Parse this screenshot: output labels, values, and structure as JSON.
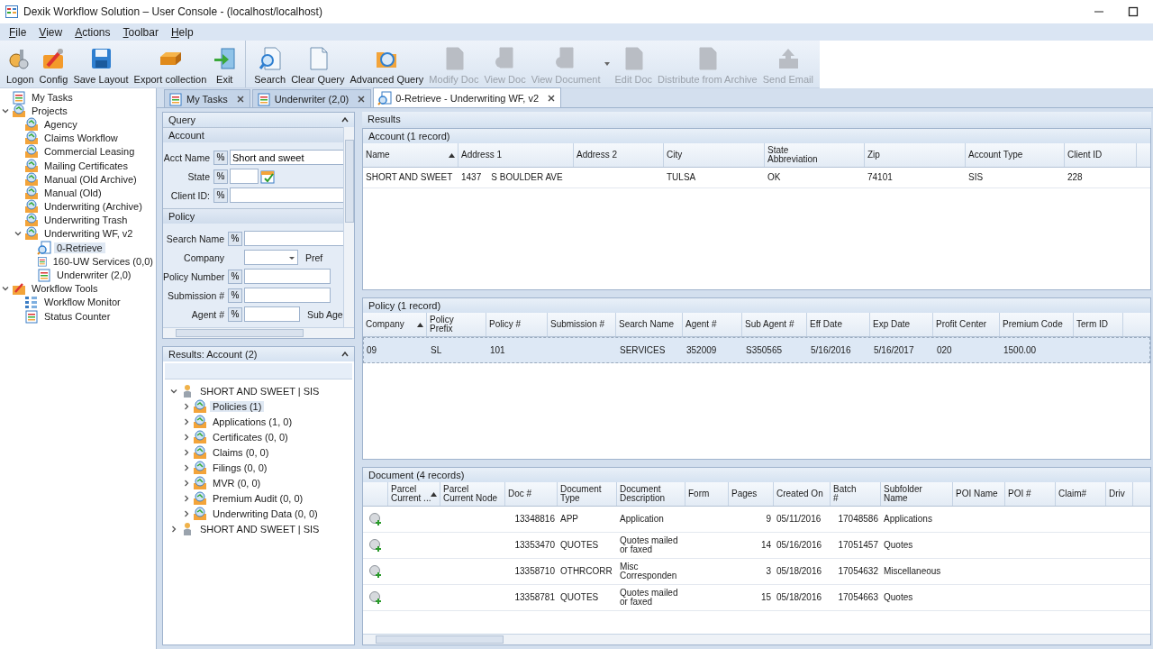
{
  "window": {
    "title": "Dexik Workflow Solution – User Console - (localhost/localhost)"
  },
  "menu": [
    "File",
    "View",
    "Actions",
    "Toolbar",
    "Help"
  ],
  "toolbar": [
    {
      "label": "Logon",
      "disabled": false,
      "menu": false,
      "group_start": false
    },
    {
      "label": "Config",
      "disabled": false,
      "menu": false,
      "group_start": false
    },
    {
      "label": "Save Layout",
      "disabled": false,
      "menu": false,
      "group_start": false
    },
    {
      "label": "Export collection",
      "disabled": false,
      "menu": false,
      "group_start": false
    },
    {
      "label": "Exit",
      "disabled": false,
      "menu": false,
      "group_start": false
    },
    {
      "label": "Search",
      "disabled": false,
      "menu": false,
      "group_start": true
    },
    {
      "label": "Clear Query",
      "disabled": false,
      "menu": false,
      "group_start": false
    },
    {
      "label": "Advanced Query",
      "disabled": false,
      "menu": false,
      "group_start": false
    },
    {
      "label": "Modify Doc",
      "disabled": true,
      "menu": false,
      "group_start": false
    },
    {
      "label": "View Doc",
      "disabled": true,
      "menu": false,
      "group_start": false
    },
    {
      "label": "View Document",
      "disabled": true,
      "menu": true,
      "group_start": false
    },
    {
      "label": "Edit Doc",
      "disabled": true,
      "menu": false,
      "group_start": false
    },
    {
      "label": "Distribute from Archive",
      "disabled": true,
      "menu": false,
      "group_start": false
    },
    {
      "label": "Send Email",
      "disabled": true,
      "menu": false,
      "group_start": false
    }
  ],
  "sidebar": {
    "items": [
      {
        "label": "My Tasks",
        "kind": "list",
        "selected": false
      },
      {
        "label": "Projects",
        "kind": "project",
        "selected": false,
        "expanded": true,
        "children": [
          {
            "label": "Agency",
            "kind": "project",
            "selected": false
          },
          {
            "label": "Claims Workflow",
            "kind": "project",
            "selected": false
          },
          {
            "label": "Commercial Leasing",
            "kind": "project",
            "selected": false
          },
          {
            "label": "Mailing Certificates",
            "kind": "project",
            "selected": false
          },
          {
            "label": "Manual (Old Archive)",
            "kind": "project",
            "selected": false
          },
          {
            "label": "Manual (Old)",
            "kind": "project",
            "selected": false
          },
          {
            "label": "Underwriting (Archive)",
            "kind": "project",
            "selected": false
          },
          {
            "label": "Underwriting Trash",
            "kind": "project",
            "selected": false
          },
          {
            "label": "Underwriting WF, v2",
            "kind": "project",
            "selected": false,
            "expanded": true,
            "children": [
              {
                "label": "0-Retrieve",
                "kind": "search",
                "selected": true
              },
              {
                "label": "160-UW Services (0,0)",
                "kind": "list",
                "selected": false
              },
              {
                "label": "Underwriter (2,0)",
                "kind": "list",
                "selected": false
              }
            ]
          }
        ]
      },
      {
        "label": "Workflow Tools",
        "kind": "tools",
        "selected": false,
        "expanded": true,
        "children": [
          {
            "label": "Workflow Monitor",
            "kind": "monitor",
            "selected": false
          },
          {
            "label": "Status Counter",
            "kind": "list",
            "selected": false
          }
        ]
      }
    ]
  },
  "tabs": [
    {
      "label": "My Tasks",
      "kind": "list",
      "selected": false
    },
    {
      "label": "Underwriter (2,0)",
      "kind": "list",
      "selected": false
    },
    {
      "label": "0-Retrieve - Underwriting WF, v2",
      "kind": "search",
      "selected": true
    }
  ],
  "query": {
    "title": "Query",
    "sections": [
      {
        "title": "Account",
        "fields": [
          {
            "label": "Acct Name",
            "operator": "%",
            "kind": "text",
            "value": "Short and sweet"
          },
          {
            "label": "State",
            "operator": "%",
            "kind": "date"
          },
          {
            "label": "Client ID:",
            "operator": "%",
            "kind": "text"
          }
        ]
      },
      {
        "title": "Policy",
        "fields": [
          {
            "label": "Search Name",
            "operator": "%",
            "kind": "text"
          },
          {
            "label": "Company",
            "kind": "dropdown",
            "side_label": "Pref"
          },
          {
            "label": "Policy Number",
            "operator": "%",
            "kind": "text"
          },
          {
            "label": "Submission #",
            "operator": "%",
            "kind": "text"
          },
          {
            "label": "Agent #",
            "operator": "%",
            "kind": "text",
            "side_label": "Sub Age"
          }
        ]
      }
    ]
  },
  "results_tree": {
    "title": "Results: Account (2)",
    "items": [
      {
        "label": "SHORT AND SWEET | SIS",
        "kind": "person",
        "selected": false,
        "expanded": true,
        "children": [
          {
            "label": "Policies (1)",
            "kind": "project",
            "selected": true,
            "expanded": false
          },
          {
            "label": "Applications (1, 0)",
            "kind": "project",
            "selected": false,
            "expanded": false
          },
          {
            "label": "Certificates (0, 0)",
            "kind": "project",
            "selected": false,
            "expanded": false
          },
          {
            "label": "Claims (0, 0)",
            "kind": "project",
            "selected": false,
            "expanded": false
          },
          {
            "label": "Filings (0, 0)",
            "kind": "project",
            "selected": false,
            "expanded": false
          },
          {
            "label": "MVR (0, 0)",
            "kind": "project",
            "selected": false,
            "expanded": false
          },
          {
            "label": "Premium Audit (0, 0)",
            "kind": "project",
            "selected": false,
            "expanded": false
          },
          {
            "label": "Underwriting Data (0, 0)",
            "kind": "project",
            "selected": false,
            "expanded": false
          }
        ]
      },
      {
        "label": "SHORT AND SWEET | SIS",
        "kind": "person",
        "selected": false,
        "expanded": false
      }
    ]
  },
  "results": {
    "title": "Results",
    "tables": [
      {
        "title": "Account (1 record)",
        "row_icons": false,
        "columns": [
          {
            "label": "Name",
            "sorted": true
          },
          {
            "label": "Address 1",
            "sorted": false
          },
          {
            "label": "Address 2",
            "sorted": false
          },
          {
            "label": "City",
            "sorted": false
          },
          {
            "label": "State\nAbbreviation",
            "sorted": false
          },
          {
            "label": "Zip",
            "sorted": false
          },
          {
            "label": "Account Type",
            "sorted": false
          },
          {
            "label": "Client ID",
            "sorted": false
          }
        ],
        "rows": [
          {
            "selected": false,
            "cells": [
              "SHORT AND SWEET",
              "1437    S BOULDER AVE",
              null,
              "TULSA",
              "OK",
              "74101",
              "SIS",
              "228"
            ]
          }
        ]
      },
      {
        "title": "Policy (1 record)",
        "row_icons": false,
        "columns": [
          {
            "label": "Company",
            "sorted": true
          },
          {
            "label": "Policy\nPrefix",
            "sorted": false
          },
          {
            "label": "Policy #",
            "sorted": false
          },
          {
            "label": "Submission #",
            "sorted": false
          },
          {
            "label": "Search Name",
            "sorted": false
          },
          {
            "label": "Agent #",
            "sorted": false
          },
          {
            "label": "Sub Agent #",
            "sorted": false
          },
          {
            "label": "Eff Date",
            "sorted": false
          },
          {
            "label": "Exp Date",
            "sorted": false
          },
          {
            "label": "Profit Center",
            "sorted": false
          },
          {
            "label": "Premium Code",
            "sorted": false
          },
          {
            "label": "Term ID",
            "sorted": false
          }
        ],
        "rows": [
          {
            "selected": true,
            "cells": [
              "09",
              "SL",
              "101",
              null,
              "SERVICES",
              "352009",
              "S350565",
              "5/16/2016",
              "5/16/2017",
              "020",
              "1500.00",
              null
            ]
          }
        ]
      },
      {
        "title": "Document (4 records)",
        "row_icons": true,
        "columns": [
          {
            "label": "Parcel\nCurrent ...",
            "sorted": true
          },
          {
            "label": "Parcel\nCurrent Node",
            "sorted": false
          },
          {
            "label": "Doc #",
            "sorted": false
          },
          {
            "label": "Document\nType",
            "sorted": false
          },
          {
            "label": "Document\nDescription",
            "sorted": false
          },
          {
            "label": "Form",
            "sorted": false
          },
          {
            "label": "Pages",
            "sorted": false
          },
          {
            "label": "Created On",
            "sorted": false
          },
          {
            "label": "Batch\n#",
            "sorted": false
          },
          {
            "label": "Subfolder\nName",
            "sorted": false
          },
          {
            "label": "POI Name",
            "sorted": false
          },
          {
            "label": "POI #",
            "sorted": false
          },
          {
            "label": "Claim#",
            "sorted": false
          },
          {
            "label": "Driv",
            "sorted": false
          }
        ],
        "rows": [
          {
            "selected": false,
            "cells": [
              null,
              null,
              "13348816",
              "APP",
              "Application",
              null,
              "9",
              "05/11/2016",
              "17048586",
              "Applications",
              null,
              null,
              null,
              null
            ]
          },
          {
            "selected": false,
            "cells": [
              null,
              null,
              "13353470",
              "QUOTES",
              "Quotes mailed\nor faxed",
              null,
              "14",
              "05/16/2016",
              "17051457",
              "Quotes",
              null,
              null,
              null,
              null
            ]
          },
          {
            "selected": false,
            "cells": [
              null,
              null,
              "13358710",
              "OTHRCORR",
              "Misc\nCorresponden",
              null,
              "3",
              "05/18/2016",
              "17054632",
              "Miscellaneous",
              null,
              null,
              null,
              null
            ]
          },
          {
            "selected": false,
            "cells": [
              null,
              null,
              "13358781",
              "QUOTES",
              "Quotes mailed\nor faxed",
              null,
              "15",
              "05/18/2016",
              "17054663",
              "Quotes",
              null,
              null,
              null,
              null
            ]
          }
        ]
      }
    ]
  }
}
